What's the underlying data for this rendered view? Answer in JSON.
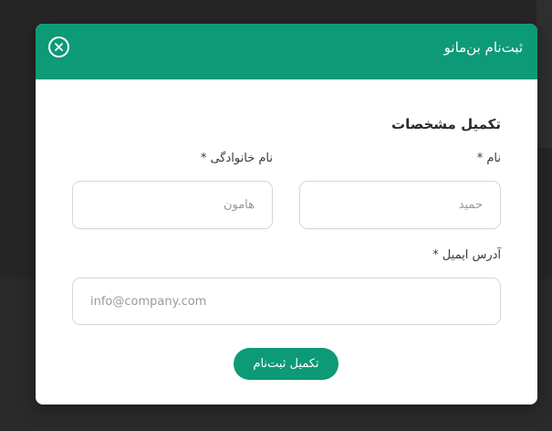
{
  "modal": {
    "title": "ثبت‌نام بن‌مانو",
    "close_icon": "close-icon"
  },
  "form": {
    "section_title": "تکمیل مشخصات",
    "first_name": {
      "label": "نام *",
      "placeholder": "حمید",
      "value": ""
    },
    "last_name": {
      "label": "نام خانوادگی *",
      "placeholder": "هامون",
      "value": ""
    },
    "email": {
      "label": "آدرس ایمیل *",
      "placeholder": "info@company.com",
      "value": ""
    },
    "submit_label": "تکمیل ثبت‌نام"
  },
  "colors": {
    "accent": "#0d9a76",
    "backdrop": "#2a2a2a"
  }
}
